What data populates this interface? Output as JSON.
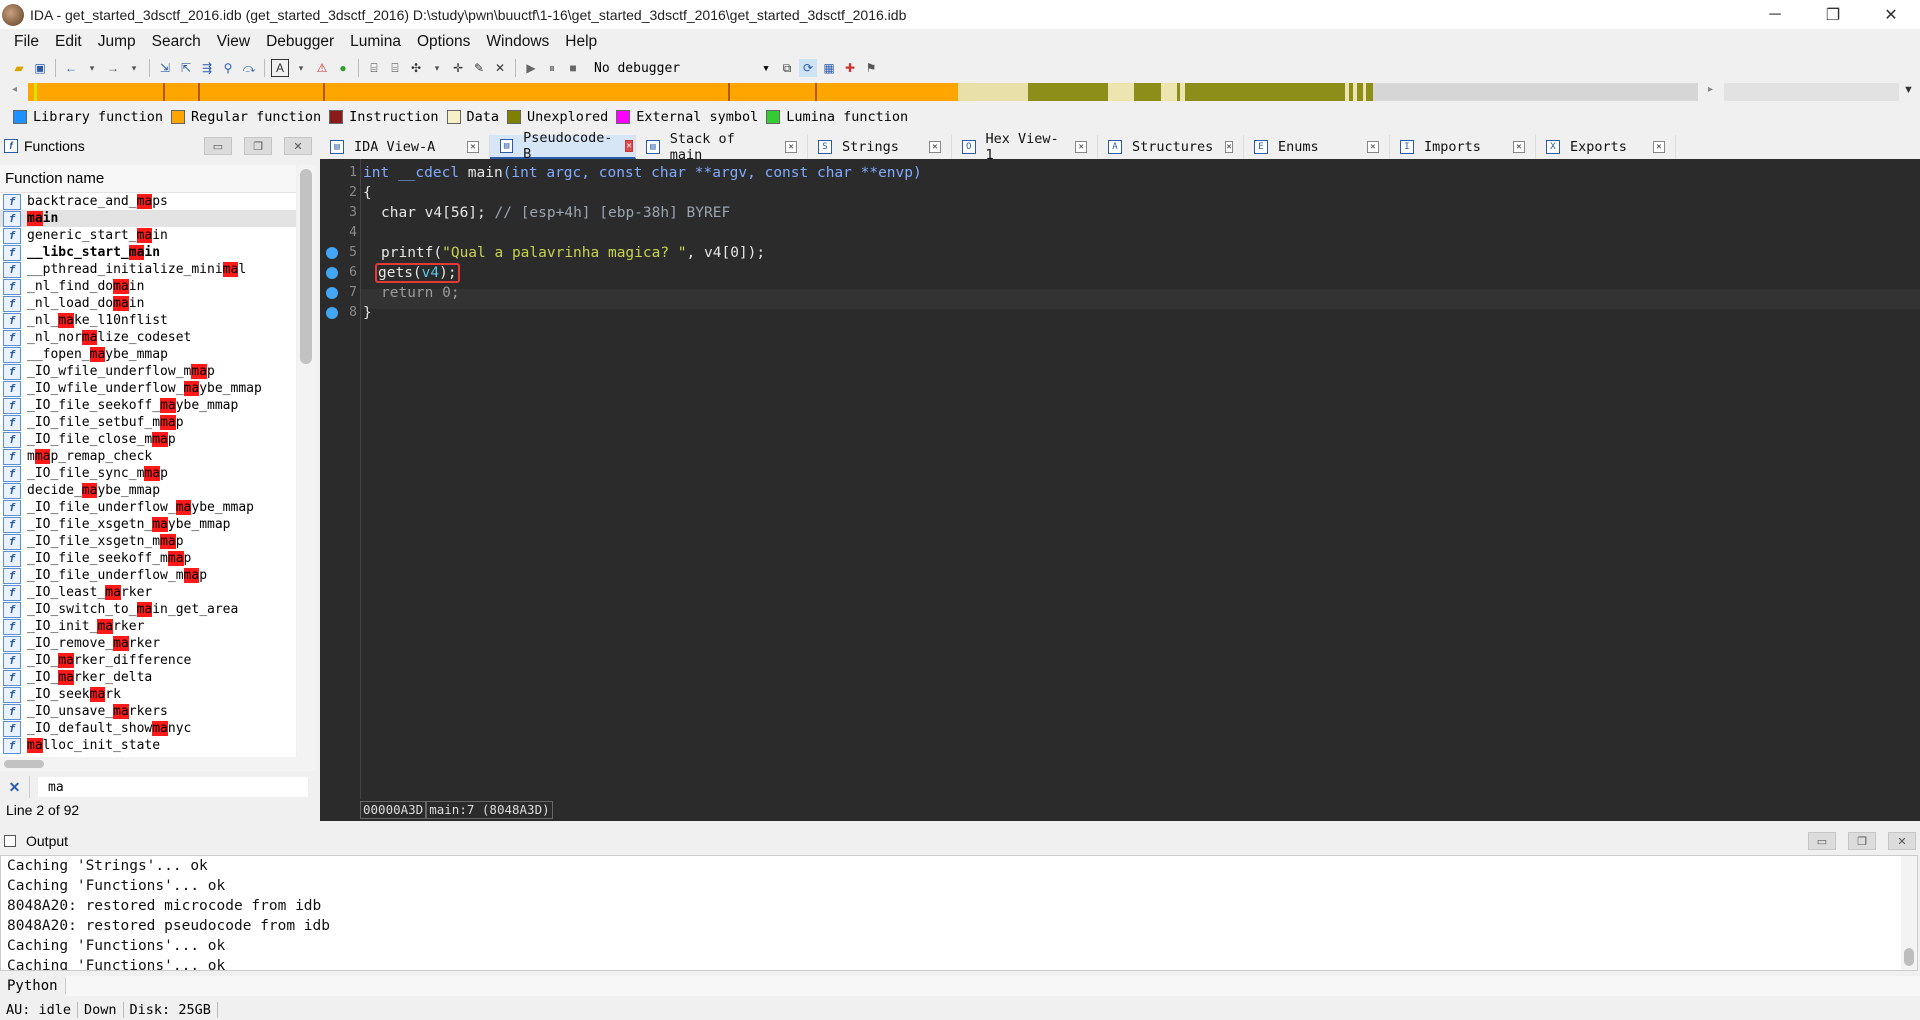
{
  "window": {
    "title": "IDA - get_started_3dsctf_2016.idb (get_started_3dsctf_2016) D:\\study\\pwn\\buuctf\\1-16\\get_started_3dsctf_2016\\get_started_3dsctf_2016.idb",
    "minimize": "─",
    "restore": "❐",
    "close": "✕"
  },
  "menu": [
    "File",
    "Edit",
    "Jump",
    "Search",
    "View",
    "Debugger",
    "Lumina",
    "Options",
    "Windows",
    "Help"
  ],
  "toolbar": {
    "debugger_selected": "No debugger"
  },
  "legend": [
    {
      "label": "Library function",
      "color": "#1e90ff"
    },
    {
      "label": "Regular function",
      "color": "#ffa500"
    },
    {
      "label": "Instruction",
      "color": "#8b1a1a"
    },
    {
      "label": "Data",
      "color": "#f5f0c8"
    },
    {
      "label": "Unexplored",
      "color": "#808000"
    },
    {
      "label": "External symbol",
      "color": "#ff00ff"
    },
    {
      "label": "Lumina function",
      "color": "#33cc33"
    }
  ],
  "functions": {
    "title": "Functions",
    "column_header": "Function name",
    "items": [
      {
        "name": "backtrace_and_maps",
        "bold": false
      },
      {
        "name": "main",
        "bold": true
      },
      {
        "name": "generic_start_main",
        "bold": false
      },
      {
        "name": "__libc_start_main",
        "bold": true
      },
      {
        "name": "__pthread_initialize_minimal",
        "bold": false
      },
      {
        "name": "_nl_find_domain",
        "bold": false
      },
      {
        "name": "_nl_load_domain",
        "bold": false
      },
      {
        "name": "_nl_make_l10nflist",
        "bold": false
      },
      {
        "name": "_nl_normalize_codeset",
        "bold": false
      },
      {
        "name": "__fopen_maybe_mmap",
        "bold": false
      },
      {
        "name": "_IO_wfile_underflow_mmap",
        "bold": false
      },
      {
        "name": "_IO_wfile_underflow_maybe_mmap",
        "bold": false
      },
      {
        "name": "_IO_file_seekoff_maybe_mmap",
        "bold": false
      },
      {
        "name": "_IO_file_setbuf_mmap",
        "bold": false
      },
      {
        "name": "_IO_file_close_mmap",
        "bold": false
      },
      {
        "name": "mmap_remap_check",
        "bold": false
      },
      {
        "name": "_IO_file_sync_mmap",
        "bold": false
      },
      {
        "name": "decide_maybe_mmap",
        "bold": false
      },
      {
        "name": "_IO_file_underflow_maybe_mmap",
        "bold": false
      },
      {
        "name": "_IO_file_xsgetn_maybe_mmap",
        "bold": false
      },
      {
        "name": "_IO_file_xsgetn_mmap",
        "bold": false
      },
      {
        "name": "_IO_file_seekoff_mmap",
        "bold": false
      },
      {
        "name": "_IO_file_underflow_mmap",
        "bold": false
      },
      {
        "name": "_IO_least_marker",
        "bold": false
      },
      {
        "name": "_IO_switch_to_main_get_area",
        "bold": false
      },
      {
        "name": "_IO_init_marker",
        "bold": false
      },
      {
        "name": "_IO_remove_marker",
        "bold": false
      },
      {
        "name": "_IO_marker_difference",
        "bold": false
      },
      {
        "name": "_IO_marker_delta",
        "bold": false
      },
      {
        "name": "_IO_seekmark",
        "bold": false
      },
      {
        "name": "_IO_unsave_markers",
        "bold": false
      },
      {
        "name": "_IO_default_showmanyc",
        "bold": false
      },
      {
        "name": "malloc_init_state",
        "bold": false
      }
    ],
    "selected_index": 1,
    "highlight": "ma",
    "highlight_color": "#ff1a1a",
    "filter_value": "ma",
    "line_status": "Line 2 of 92"
  },
  "tabs": [
    {
      "label": "IDA View-A",
      "icon": "▤",
      "active": false
    },
    {
      "label": "Pseudocode-B",
      "icon": "▤",
      "active": true
    },
    {
      "label": "Stack of main",
      "icon": "▤",
      "active": false
    },
    {
      "label": "Strings",
      "icon": "S",
      "active": false
    },
    {
      "label": "Hex View-1",
      "icon": "O",
      "active": false
    },
    {
      "label": "Structures",
      "icon": "A",
      "active": false
    },
    {
      "label": "Enums",
      "icon": "E",
      "active": false
    },
    {
      "label": "Imports",
      "icon": "I",
      "active": false
    },
    {
      "label": "Exports",
      "icon": "X",
      "active": false
    }
  ],
  "pseudocode": {
    "line_numbers": [
      "1",
      "2",
      "3",
      "4",
      "5",
      "6",
      "7",
      "8"
    ],
    "l1_type": "int",
    "l1_cc": "__cdecl",
    "l1_fn": "main",
    "l1_args": "(int argc, const char **argv, const char **envp)",
    "l2": "{",
    "l3_decl": "char v4[56];",
    "l3_comment": "// [esp+4h] [ebp-38h] BYREF",
    "l5_fn": "printf(",
    "l5_str": "\"Qual a palavrinha magica? \"",
    "l5_rest": ", v4[0]);",
    "l6_fn": "gets(",
    "l6_arg": "v4",
    "l6_end": ");",
    "l7": "return 0;",
    "l8": "}"
  },
  "code_status": {
    "address": "00000A3D",
    "location": "main:7 (8048A3D)"
  },
  "output": {
    "title": "Output",
    "lines": [
      "Caching 'Strings'... ok",
      "Caching 'Functions'... ok",
      "8048A20: restored microcode from idb",
      "8048A20: restored pseudocode from idb",
      "Caching 'Functions'... ok",
      "Caching 'Functions'... ok"
    ]
  },
  "python_label": "Python",
  "statusbar": {
    "au": "AU:  idle",
    "direction": "Down",
    "disk": "Disk: 25GB"
  }
}
